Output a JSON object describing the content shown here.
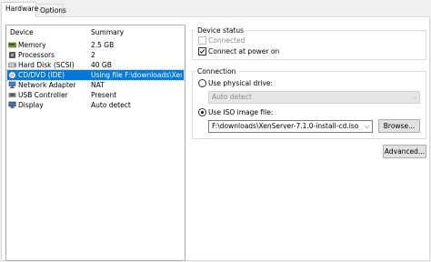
{
  "tabs": [
    {
      "label": "Hardware",
      "active": true
    },
    {
      "label": "Options",
      "active": false
    }
  ],
  "device_list": {
    "headers": {
      "device": "Device",
      "summary": "Summary"
    },
    "rows": [
      {
        "icon": "memory-icon",
        "name": "Memory",
        "summary": "2.5 GB",
        "selected": false
      },
      {
        "icon": "processor-icon",
        "name": "Processors",
        "summary": "2",
        "selected": false
      },
      {
        "icon": "hard-disk-icon",
        "name": "Hard Disk (SCSI)",
        "summary": "40 GB",
        "selected": false
      },
      {
        "icon": "cd-dvd-icon",
        "name": "CD/DVD (IDE)",
        "summary": "Using file F:\\downloads\\Xen...",
        "selected": true
      },
      {
        "icon": "network-adapter-icon",
        "name": "Network Adapter",
        "summary": "NAT",
        "selected": false
      },
      {
        "icon": "usb-controller-icon",
        "name": "USB Controller",
        "summary": "Present",
        "selected": false
      },
      {
        "icon": "display-icon",
        "name": "Display",
        "summary": "Auto detect",
        "selected": false
      }
    ]
  },
  "device_status": {
    "title": "Device status",
    "connected_label": "Connected",
    "connected_checked": false,
    "connect_at_power_on_label": "Connect at power on",
    "connect_at_power_on_checked": true
  },
  "connection": {
    "title": "Connection",
    "physical_label": "Use physical drive:",
    "physical_selected": false,
    "physical_value": "Auto detect",
    "iso_label": "Use ISO image file:",
    "iso_selected": true,
    "iso_value": "F:\\downloads\\XenServer-7.1.0-install-cd.iso",
    "browse_label": "Browse..."
  },
  "advanced_label": "Advanced...",
  "colors": {
    "selection": "#0078d7",
    "window_bg": "#f0f0f0"
  }
}
